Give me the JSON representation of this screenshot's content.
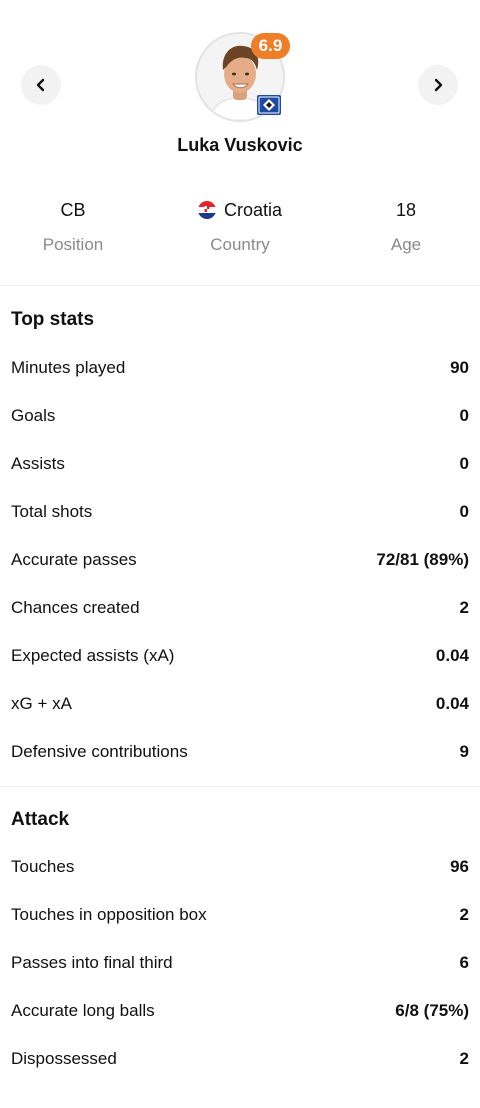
{
  "header": {
    "rating": "6.9",
    "player_name": "Luka Vuskovic",
    "info": [
      {
        "value": "CB",
        "label": "Position"
      },
      {
        "value": "Croatia",
        "label": "Country"
      },
      {
        "value": "18",
        "label": "Age"
      }
    ],
    "icons": [
      "chevron-left-icon",
      "chevron-right-icon"
    ],
    "colors": {
      "rating_badge": "#ee7e27",
      "club_badge": "#1f4aa3"
    }
  },
  "top_stats": {
    "title": "Top stats",
    "rows": [
      {
        "label": "Minutes played",
        "value": "90"
      },
      {
        "label": "Goals",
        "value": "0"
      },
      {
        "label": "Assists",
        "value": "0"
      },
      {
        "label": "Total shots",
        "value": "0"
      },
      {
        "label": "Accurate passes",
        "value": "72/81 (89%)"
      },
      {
        "label": "Chances created",
        "value": "2"
      },
      {
        "label": "Expected assists (xA)",
        "value": "0.04"
      },
      {
        "label": "xG + xA",
        "value": "0.04"
      },
      {
        "label": "Defensive contributions",
        "value": "9"
      }
    ]
  },
  "attack": {
    "title": "Attack",
    "rows": [
      {
        "label": "Touches",
        "value": "96"
      },
      {
        "label": "Touches in opposition box",
        "value": "2"
      },
      {
        "label": "Passes into final third",
        "value": "6"
      },
      {
        "label": "Accurate long balls",
        "value": "6/8 (75%)"
      },
      {
        "label": "Dispossessed",
        "value": "2"
      }
    ]
  }
}
